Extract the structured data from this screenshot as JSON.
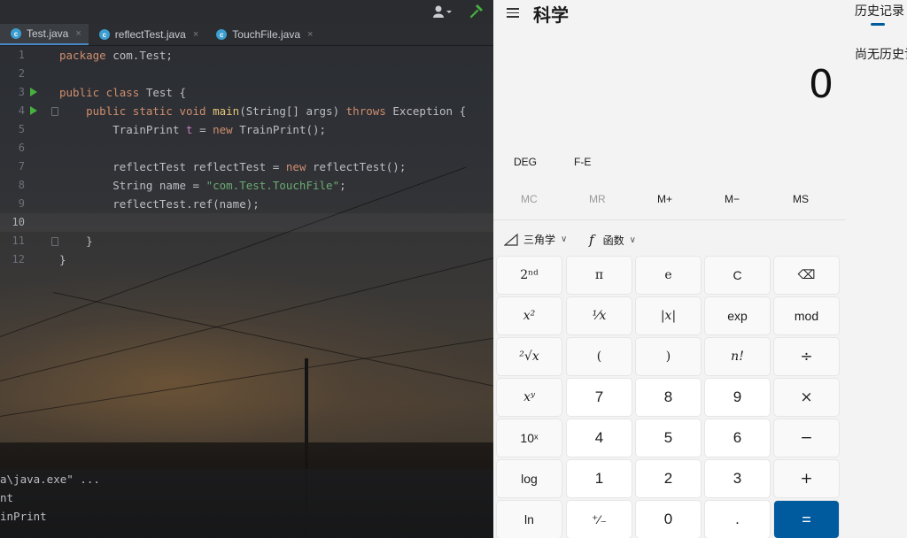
{
  "ide": {
    "tabs": [
      {
        "label": "Test.java",
        "active": true,
        "icon": "java-class-icon"
      },
      {
        "label": "reflectTest.java",
        "active": false,
        "icon": "java-class-icon"
      },
      {
        "label": "TouchFile.java",
        "active": false,
        "icon": "java-class-icon"
      }
    ],
    "tab_close": "×",
    "class_icon_glyph": "c",
    "line_numbers": [
      "1",
      "2",
      "3",
      "4",
      "5",
      "6",
      "7",
      "8",
      "9",
      "10",
      "11",
      "12"
    ],
    "code": {
      "l1_kw": "package",
      "l1_rest": " com.Test;",
      "l3_kw": "public class",
      "l3_rest": " Test {",
      "l4_kw1": "public static void ",
      "l4_fn": "main",
      "l4_mid": "(String[] args) ",
      "l4_kw2": "throws",
      "l4_rest": " Exception {",
      "l5_a": "TrainPrint ",
      "l5_var": "t",
      "l5_b": " = ",
      "l5_kw": "new",
      "l5_c": " TrainPrint();",
      "l7_a": "reflectTest reflectTest = ",
      "l7_kw": "new",
      "l7_c": " reflectTest();",
      "l8_a": "String name = ",
      "l8_str": "\"com.Test.TouchFile\"",
      "l8_c": ";",
      "l9": "reflectTest.ref(name);",
      "l11": "}",
      "l12": "}"
    },
    "console": [
      "a\\java.exe\" ...",
      "nt",
      "inPrint"
    ],
    "colors": {
      "keyword": "#cf8e6d",
      "function": "#e8c67a",
      "string": "#6aab73",
      "variable": "#c77dbb"
    }
  },
  "calculator": {
    "menu_icon": "hamburger-icon",
    "mode": "科学",
    "display": "0",
    "angle_mode": "DEG",
    "fe": "F-E",
    "memory": [
      {
        "label": "MC",
        "enabled": false
      },
      {
        "label": "MR",
        "enabled": false
      },
      {
        "label": "M+",
        "enabled": true
      },
      {
        "label": "M−",
        "enabled": true
      },
      {
        "label": "MS",
        "enabled": true
      }
    ],
    "trig_label": "三角学",
    "func_label": "函数",
    "dropdown_glyph": "∨",
    "keys": [
      [
        "2ⁿᵈ",
        "π",
        "e",
        "C",
        "⌫"
      ],
      [
        "x²",
        "¹⁄x",
        "|x|",
        "exp",
        "mod"
      ],
      [
        "²√x",
        "(",
        ")",
        "n!",
        "÷"
      ],
      [
        "xʸ",
        "7",
        "8",
        "9",
        "×"
      ],
      [
        "10ˣ",
        "4",
        "5",
        "6",
        "−"
      ],
      [
        "log",
        "1",
        "2",
        "3",
        "+"
      ],
      [
        "ln",
        "⁺⁄₋",
        "0",
        ".",
        "="
      ]
    ],
    "accent": "#005a9e"
  },
  "history": {
    "tab_label": "历史记录",
    "empty_text": "尚无历史记录"
  }
}
